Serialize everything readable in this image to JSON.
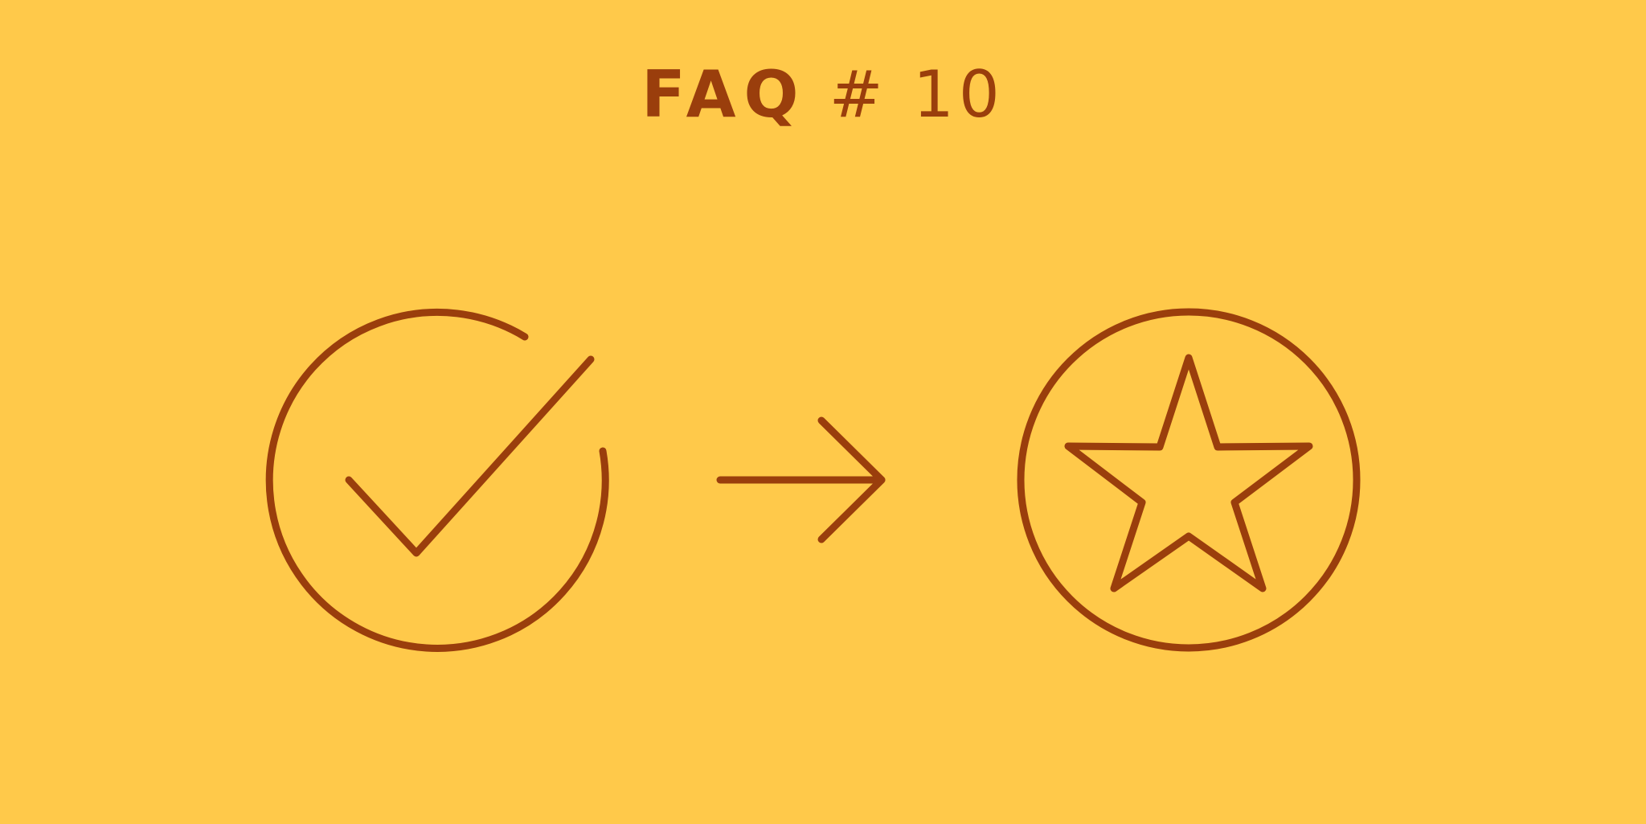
{
  "title": {
    "bold": "FAQ",
    "light": "# 10"
  },
  "icons": [
    "check-circle-icon",
    "arrow-right-icon",
    "star-circle-icon"
  ],
  "colors": {
    "background": "#FFC94A",
    "ink": "#9A3E0C"
  }
}
